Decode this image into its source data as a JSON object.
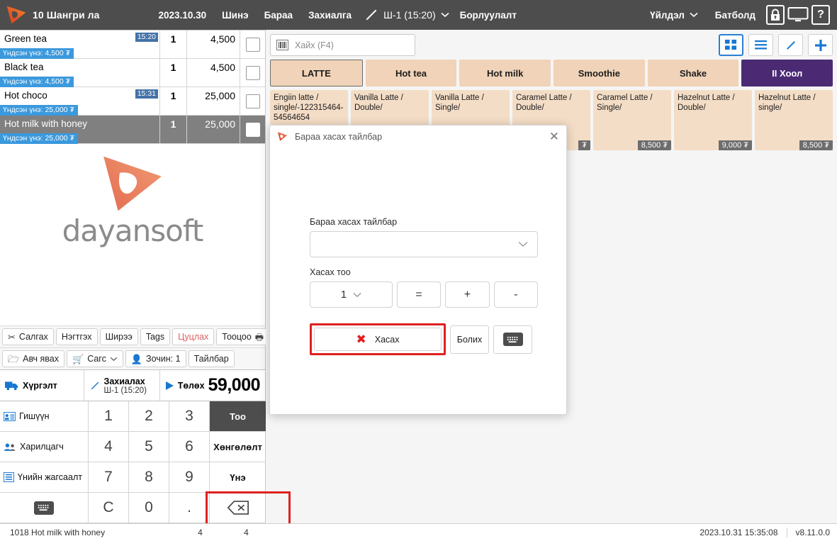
{
  "topbar": {
    "store": "10 Шангри ла",
    "date": "2023.10.30",
    "menu": [
      "Шинэ",
      "Бараа",
      "Захиалга"
    ],
    "session": "Ш-1 (15:20)",
    "mode": "Борлуулалт",
    "action_menu": "Үйлдэл",
    "user": "Батболд",
    "icons": [
      "lock-icon",
      "monitor-icon",
      "help-icon"
    ],
    "help_glyph": "?",
    "lock_glyph": "A"
  },
  "order": {
    "rows": [
      {
        "name": "Green tea",
        "base": "Үндсэн үнэ: 4,500 ₮",
        "time": "15:20",
        "qty": "1",
        "price": "4,500",
        "selected": false
      },
      {
        "name": "Black tea",
        "base": "Үндсэн үнэ: 4,500 ₮",
        "time": "",
        "qty": "1",
        "price": "4,500",
        "selected": false
      },
      {
        "name": "Hot choco",
        "base": "Үндсэн үнэ: 25,000 ₮",
        "time": "15:31",
        "qty": "1",
        "price": "25,000",
        "selected": false
      },
      {
        "name": "Hot milk with honey",
        "base": "Үндсэн үнэ: 25,000 ₮",
        "time": "",
        "qty": "1",
        "price": "25,000",
        "selected": true
      }
    ]
  },
  "watermark": {
    "text": "dayansoft"
  },
  "toolbar1": [
    {
      "label": "Салгах",
      "icon": "scissors-icon",
      "glyph": "✂",
      "danger": false,
      "trailing": ""
    },
    {
      "label": "Нэгтгэх",
      "icon": "",
      "glyph": "",
      "danger": false,
      "trailing": ""
    },
    {
      "label": "Ширээ",
      "icon": "",
      "glyph": "",
      "danger": false,
      "trailing": ""
    },
    {
      "label": "Tags",
      "icon": "",
      "glyph": "",
      "danger": false,
      "trailing": ""
    },
    {
      "label": "Цуцлах",
      "icon": "",
      "glyph": "",
      "danger": true,
      "trailing": ""
    },
    {
      "label": "Тооцоо",
      "icon": "",
      "glyph": "",
      "danger": false,
      "trailing": "🖶"
    }
  ],
  "toolbar2": [
    {
      "label": "Авч явах",
      "icon": "box-icon",
      "glyph": "🗁",
      "chevron": false
    },
    {
      "label": "Сагс",
      "icon": "cart-icon",
      "glyph": "🛒",
      "chevron": true
    },
    {
      "label": "Зочин: 1",
      "icon": "user-icon",
      "glyph": "👤",
      "chevron": false
    },
    {
      "label": "Тайлбар",
      "icon": "",
      "glyph": "",
      "chevron": false
    }
  ],
  "totalbar": {
    "delivery_label": "Хүргэлт",
    "order_label": "Захиалах",
    "order_sub": "Ш-1 (15:20)",
    "pay_label": "Төлөх",
    "amount": "59,000"
  },
  "numpad": {
    "side": [
      {
        "label": "Гишүүн",
        "icon": "member-card-icon"
      },
      {
        "label": "Харилцагч",
        "icon": "customers-icon"
      },
      {
        "label": "Үнийн жагсаалт",
        "icon": "price-list-icon"
      },
      {
        "label": "",
        "icon": "keyboard-icon"
      }
    ],
    "digits": [
      [
        "1",
        "2",
        "3"
      ],
      [
        "4",
        "5",
        "6"
      ],
      [
        "7",
        "8",
        "9"
      ],
      [
        "C",
        "0",
        "."
      ]
    ],
    "actions": [
      "Тоо",
      "Хөнгөлөлт",
      "Үнэ",
      "backspace-icon"
    ],
    "backspace_glyph": "⌫"
  },
  "statusbar": {
    "item": "1018 Hot milk with honey",
    "n1": "4",
    "n2": "4",
    "datetime": "2023.10.31 15:35:08",
    "version": "v8.11.0.0"
  },
  "search": {
    "placeholder": "Хайх (F4)",
    "value": "",
    "icon": "barcode-icon"
  },
  "viewbuttons": [
    {
      "name": "grid-view-button",
      "glyph": "▦",
      "active": true
    },
    {
      "name": "list-view-button",
      "glyph": "☰",
      "active": false
    },
    {
      "name": "edit-button",
      "glyph": "✎",
      "active": false
    },
    {
      "name": "add-button",
      "glyph": "✚",
      "active": false
    }
  ],
  "categories": [
    {
      "label": "LATTE",
      "active": true,
      "purple": false
    },
    {
      "label": "Hot tea",
      "active": false,
      "purple": false
    },
    {
      "label": "Hot milk",
      "active": false,
      "purple": false
    },
    {
      "label": "Smoothie",
      "active": false,
      "purple": false
    },
    {
      "label": "Shake",
      "active": false,
      "purple": false
    },
    {
      "label": "II Хоол",
      "active": false,
      "purple": true
    }
  ],
  "products": [
    {
      "name": "Engiin latte / single/-122315464-54564654",
      "price": ""
    },
    {
      "name": "Vanilla Latte / Double/",
      "price": ""
    },
    {
      "name": "Vanilla Latte / Single/",
      "price": ""
    },
    {
      "name": "Caramel Latte / Double/",
      "price": "₮"
    },
    {
      "name": "Caramel Latte / Single/",
      "price": "8,500 ₮"
    },
    {
      "name": "Hazelnut Latte / Double/",
      "price": "9,000 ₮"
    },
    {
      "name": "Hazelnut Latte / single/",
      "price": "8,500 ₮"
    }
  ],
  "modal": {
    "title": "Бараа хасах тайлбар",
    "close_icon": "close-icon",
    "reason_label": "Бараа хасах тайлбар",
    "reason_value": "",
    "qty_label": "Хасах тоо",
    "qty_value": "1",
    "equals_label": "=",
    "plus_label": "+",
    "minus_label": "-",
    "confirm_label": "Хасах",
    "cancel_label": "Болих",
    "keyboard_icon": "keyboard-icon"
  },
  "colors": {
    "topbar_bg": "#4d4d4d",
    "accent_blue": "#2b7fd4",
    "badge_blue": "#3b99dd",
    "product_bg": "#f4ddc6",
    "category_bg": "#f0d3b8",
    "purple": "#4b2a73",
    "highlight_red": "#e02020",
    "brand_orange": "#e8613c"
  }
}
